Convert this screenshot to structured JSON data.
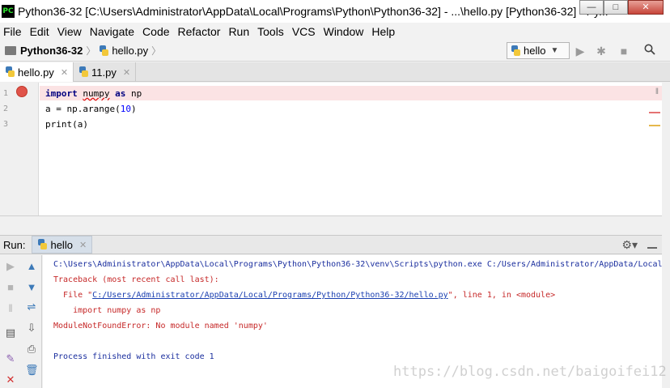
{
  "window": {
    "title": "Python36-32 [C:\\Users\\Administrator\\AppData\\Local\\Programs\\Python\\Python36-32] - ...\\hello.py [Python36-32] - Py...",
    "app_icon_text": "PC",
    "buttons": {
      "minimize": "—",
      "maximize": "□",
      "close": "✕"
    }
  },
  "menu": [
    "File",
    "Edit",
    "View",
    "Navigate",
    "Code",
    "Refactor",
    "Run",
    "Tools",
    "VCS",
    "Window",
    "Help"
  ],
  "breadcrumb": {
    "project": "Python36-32",
    "file": "hello.py"
  },
  "run_config": {
    "selected": "hello"
  },
  "toolbar_icons": [
    "run-icon",
    "debug-icon",
    "stop-icon",
    "search-icon"
  ],
  "editor_tabs": [
    {
      "label": "hello.py",
      "active": true
    },
    {
      "label": "11.py",
      "active": false
    }
  ],
  "editor": {
    "line_numbers": [
      "1",
      "2",
      "3"
    ],
    "lines": [
      {
        "import_kw": "import",
        "module": "numpy",
        "as_kw": "as",
        "alias": "np"
      },
      {
        "prefix": "a = ",
        "obj": "np",
        "rest": ".arange(",
        "arg": "10",
        "close": ")"
      },
      {
        "text": "print(a)"
      }
    ],
    "breakpoint_line": "1"
  },
  "run_panel": {
    "label": "Run:",
    "tab": "hello",
    "console": {
      "cmd": "C:\\Users\\Administrator\\AppData\\Local\\Programs\\Python\\Python36-32\\venv\\Scripts\\python.exe C:/Users/Administrator/AppData/Local",
      "traceback": "Traceback (most recent call last):",
      "file_prefix": "  File \"",
      "file_link": "C:/Users/Administrator/AppData/Local/Programs/Python/Python36-32/hello.py",
      "file_suffix": "\", line 1, in <module>",
      "code": "    import numpy as np",
      "error": "ModuleNotFoundError: No module named 'numpy'",
      "exit": "Process finished with exit code 1"
    }
  },
  "watermark": "https://blog.csdn.net/baigoifei12",
  "colors": {
    "error": "#c62828",
    "link": "#1a3fb0",
    "breakpoint": "#e0534a",
    "highlight": "#fbe3e4",
    "keyword": "#000080"
  }
}
